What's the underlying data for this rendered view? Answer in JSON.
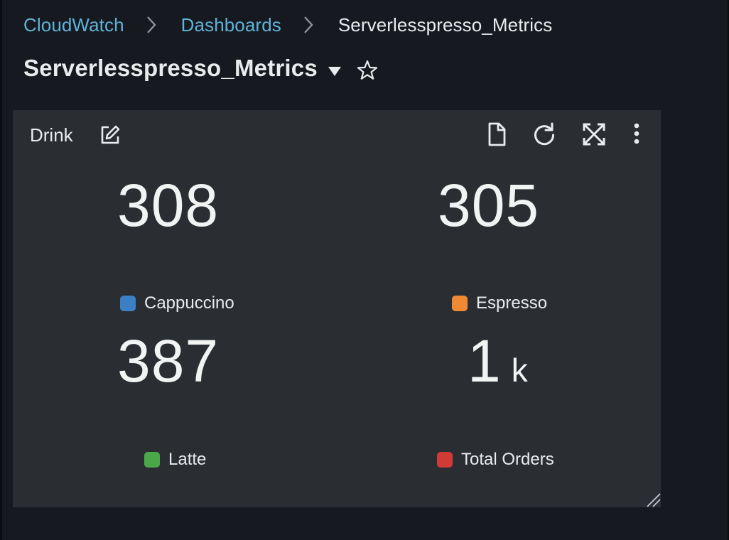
{
  "breadcrumb": {
    "items": [
      {
        "label": "CloudWatch"
      },
      {
        "label": "Dashboards"
      },
      {
        "label": "Serverlesspresso_Metrics"
      }
    ]
  },
  "page": {
    "title": "Serverlesspresso_Metrics"
  },
  "widget": {
    "title": "Drink",
    "metrics": [
      {
        "value": "308",
        "unit": "",
        "label": "Cappuccino",
        "color": "#3b7fc4"
      },
      {
        "value": "305",
        "unit": "",
        "label": "Espresso",
        "color": "#f08934"
      },
      {
        "value": "387",
        "unit": "",
        "label": "Latte",
        "color": "#4aa84a"
      },
      {
        "value": "1",
        "unit": "k",
        "label": "Total Orders",
        "color": "#d13b35"
      }
    ],
    "icons": {
      "edit": "edit-icon",
      "doc": "document-icon",
      "refresh": "refresh-icon",
      "expand": "expand-icon",
      "more": "more-vertical-icon"
    }
  }
}
